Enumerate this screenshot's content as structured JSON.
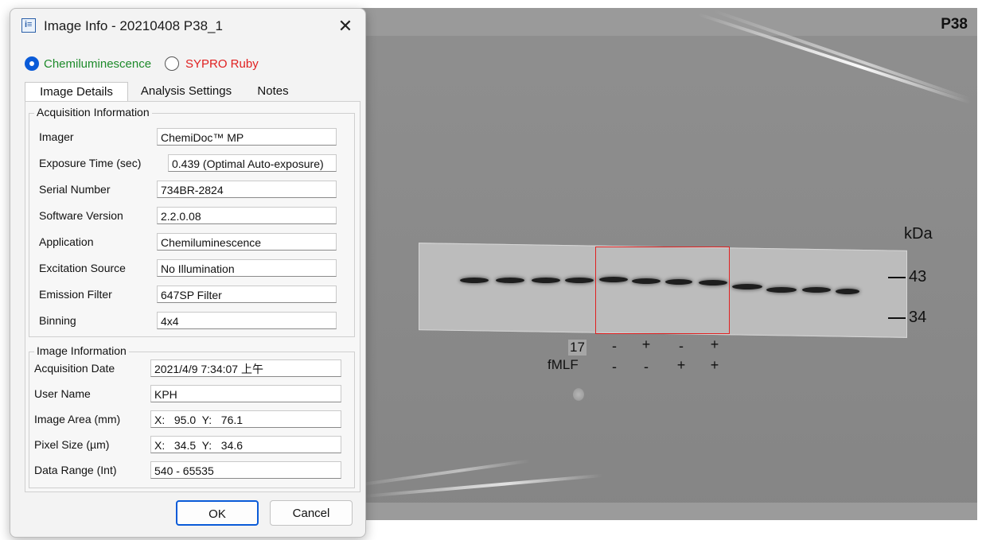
{
  "dialog": {
    "title": "Image Info - 20210408 P38_1",
    "close_glyph": "✕",
    "radio": {
      "chemiluminescence": "Chemiluminescence",
      "sypro_ruby": "SYPRO Ruby",
      "selected": "Chemiluminescence"
    },
    "tabs": [
      "Image Details",
      "Analysis Settings",
      "Notes"
    ],
    "acquisition": {
      "title": "Acquisition Information",
      "rows": [
        {
          "label": "Imager",
          "value": "ChemiDoc™ MP"
        },
        {
          "label": "Exposure Time (sec)",
          "value": "0.439 (Optimal Auto-exposure)"
        },
        {
          "label": "Serial Number",
          "value": "734BR-2824"
        },
        {
          "label": "Software Version",
          "value": "2.2.0.08"
        },
        {
          "label": "Application",
          "value": "Chemiluminescence"
        },
        {
          "label": "Excitation Source",
          "value": "No Illumination"
        },
        {
          "label": "Emission Filter",
          "value": "647SP Filter"
        },
        {
          "label": "Binning",
          "value": "4x4"
        }
      ]
    },
    "image_info": {
      "title": "Image Information",
      "rows": [
        {
          "label": "Acquisition Date",
          "value": "2021/4/9 7:34:07 上午"
        },
        {
          "label": "User Name",
          "value": "KPH"
        },
        {
          "label": "Image Area (mm)",
          "value": "X:   95.0  Y:   76.1"
        },
        {
          "label": "Pixel Size (µm)",
          "value": "X:   34.5  Y:   34.6"
        },
        {
          "label": "Data Range (Int)",
          "value": "540 - 65535"
        }
      ]
    },
    "buttons": {
      "ok": "OK",
      "cancel": "Cancel"
    }
  },
  "gel": {
    "protein_label": "P38",
    "unit_label": "kDa",
    "markers": [
      "43",
      "34"
    ],
    "treatments": [
      {
        "name": "17",
        "signs": [
          "-",
          "+",
          "-",
          "+"
        ]
      },
      {
        "name": "fMLF",
        "signs": [
          "-",
          "-",
          "+",
          "+"
        ]
      }
    ],
    "highlight_color": "#e02020"
  },
  "colors": {
    "accent": "#0a5bd8",
    "chemi_text": "#1d8a2a",
    "sypro_text": "#e02020"
  },
  "icons": {
    "title": "info-window-icon",
    "close": "close-icon"
  }
}
